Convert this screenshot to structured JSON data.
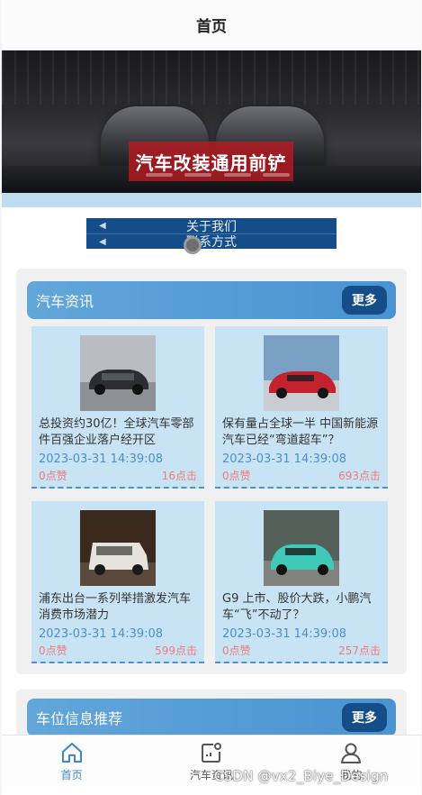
{
  "header": {
    "title": "首页"
  },
  "banner": {
    "headline": "汽车改装通用前铲"
  },
  "menu": {
    "items": [
      {
        "label": "关于我们"
      },
      {
        "label": "联系方式"
      }
    ]
  },
  "news": {
    "title": "汽车资讯",
    "more_label": "更多",
    "items": [
      {
        "title": "总投资约30亿！全球汽车零部件百强企业落户经开区",
        "time": "2023-03-31 14:39:08",
        "likes": "0点赞",
        "clicks": "16点击",
        "image": "dark-sports-car-photo"
      },
      {
        "title": "保有量占全球一半 中国新能源汽车已经“弯道超车”？",
        "time": "2023-03-31 14:39:08",
        "likes": "0点赞",
        "clicks": "693点击",
        "image": "red-concept-car-photo"
      },
      {
        "title": "浦东出台一系列举措激发汽车消费市场潜力",
        "time": "2023-03-31 14:39:08",
        "likes": "0点赞",
        "clicks": "599点击",
        "image": "white-suv-photo"
      },
      {
        "title": "G9 上市、股价大跌，小鹏汽车“飞”不动了？",
        "time": "2023-03-31 14:39:08",
        "likes": "0点赞",
        "clicks": "257点击",
        "image": "teal-suv-photo"
      }
    ]
  },
  "parking": {
    "title": "车位信息推荐",
    "more_label": "更多"
  },
  "tabbar": {
    "tabs": [
      {
        "label": "首页",
        "icon": "home-icon",
        "active": true
      },
      {
        "label": "汽车资讯",
        "icon": "news-icon",
        "active": false
      },
      {
        "label": "我的",
        "icon": "user-icon",
        "active": false
      }
    ]
  },
  "watermark": "CSDN @vx2_Biye_Design",
  "colors": {
    "accent": "#4a93d1",
    "dark_blue": "#154d88",
    "card_bg": "#c8e4f4",
    "like_red": "#f07b7b"
  }
}
